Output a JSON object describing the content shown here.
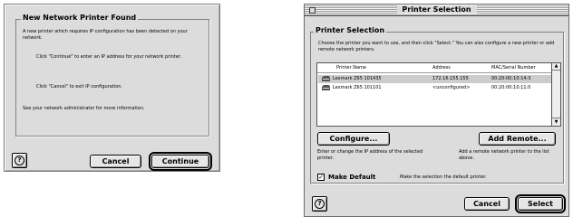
{
  "dialog1": {
    "title": "New Network Printer Found",
    "msg1": "A new printer which requires IP configuration has been detected on your network.",
    "msg2": "Click \"Continue\" to enter an IP address for your network printer.",
    "msg3": "Click \"Cancel\" to exit IP configuration.",
    "msg4": "See your network administrator for more information.",
    "help_label": "?",
    "cancel_label": "Cancel",
    "continue_label": "Continue"
  },
  "dialog2": {
    "window_title": "Printer Selection",
    "group_title": "Printer Selection",
    "instructions": "Choose the printer you want to use, and then click \"Select.\" You can also configure a new printer or add remote network printers.",
    "columns": [
      "Printer Name",
      "Address",
      "MAC/Serial Number"
    ],
    "rows": [
      {
        "name": "Lexmark Z65 101435",
        "address": "172.16.155.155",
        "mac": "00:20:00:10:14:3",
        "selected": true
      },
      {
        "name": "Lexmark Z65 101101",
        "address": "<unconfigured>",
        "mac": "00:20:00:10:11:0",
        "selected": false
      }
    ],
    "configure_label": "Configure...",
    "add_remote_label": "Add Remote...",
    "configure_desc": "Enter or change the IP address of the selected printer.",
    "add_remote_desc": "Add a remote network printer to the list above.",
    "make_default_label": "Make Default",
    "make_default_checked": true,
    "make_default_desc": "Make the selection the default printer.",
    "help_label": "?",
    "cancel_label": "Cancel",
    "select_label": "Select"
  }
}
